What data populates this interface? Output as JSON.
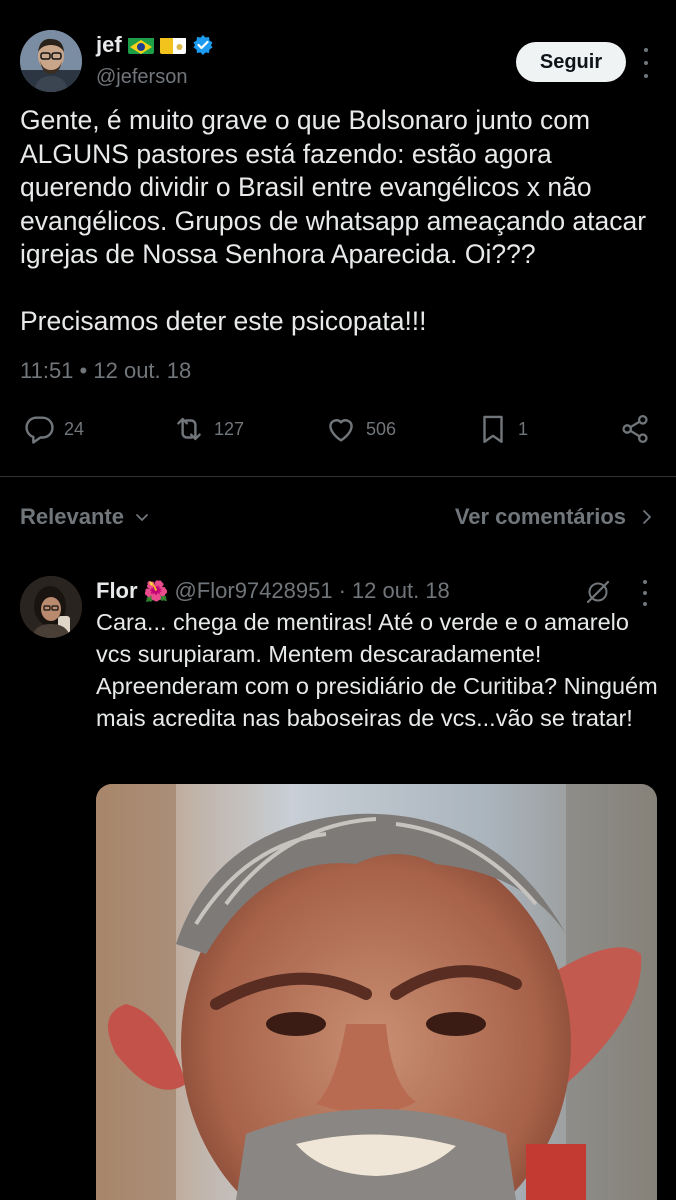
{
  "tweet": {
    "author_name": "jef",
    "author_handle": "@jeferson",
    "follow_label": "Seguir",
    "text": "Gente, é muito grave o que Bolsonaro junto com ALGUNS pastores está fazendo: estão agora querendo dividir o Brasil entre evangélicos x não evangélicos. Grupos de whatsapp ameaçando atacar igrejas de Nossa Senhora Aparecida. Oi???\n\nPrecisamos deter este psicopata!!!",
    "time": "11:51",
    "date": "12 out. 18",
    "separator": "•",
    "stats": {
      "replies": "24",
      "retweets": "127",
      "likes": "506",
      "bookmarks": "1"
    }
  },
  "sort": {
    "label": "Relevante",
    "view_comments": "Ver comentários"
  },
  "reply": {
    "name": "Flor",
    "emoji": "🌺",
    "handle": "@Flor97428951",
    "dot": "·",
    "date": "12 out. 18",
    "text": "Cara... chega de mentiras! Até o verde e o amarelo vcs surupiaram. Mentem descaradamente! Apreenderam com o presidiário de Curitiba? Ninguém mais acredita nas baboseiras de vcs...vão se tratar!"
  },
  "icons": {
    "reply": "reply-icon",
    "retweet": "retweet-icon",
    "like": "heart-icon",
    "bookmark": "bookmark-icon",
    "share": "share-icon",
    "more": "more-icon",
    "verified": "verified-badge-icon",
    "grok": "grok-icon"
  },
  "colors": {
    "background": "#000000",
    "text": "#e7e9ea",
    "muted": "#71767b",
    "divider": "#2f3336",
    "verified": "#1d9bf0"
  }
}
